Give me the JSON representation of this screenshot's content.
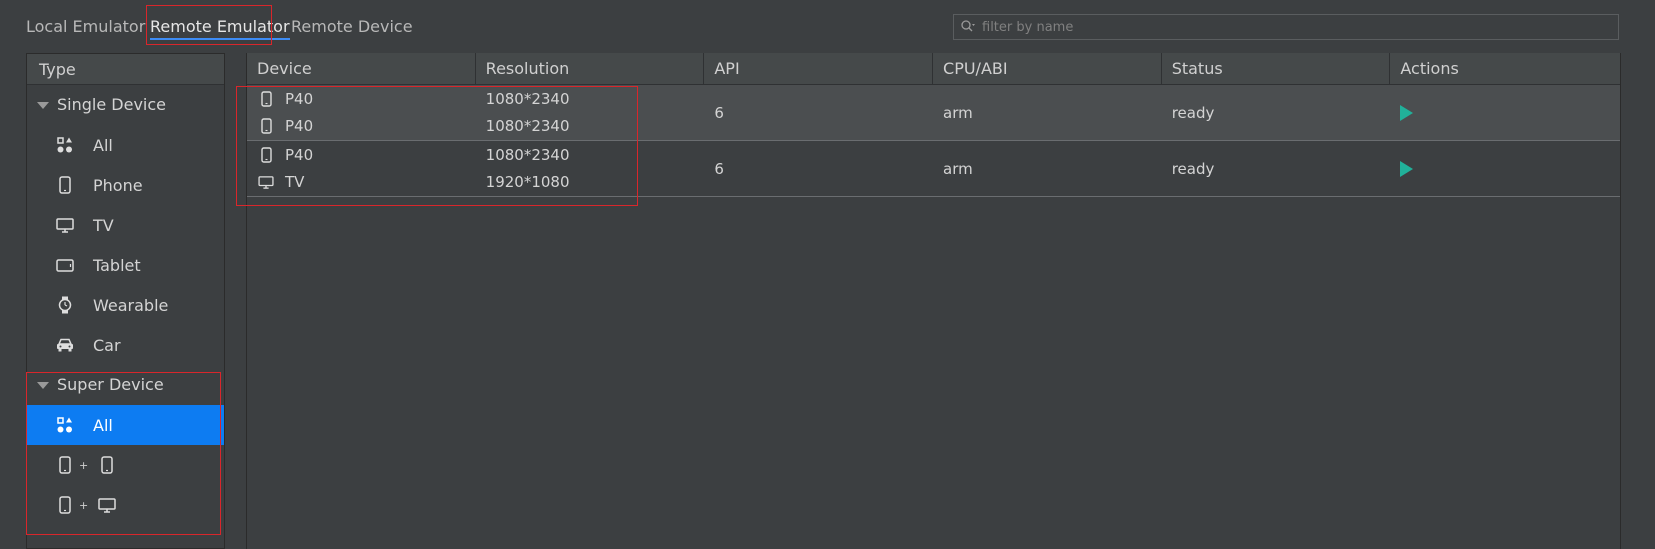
{
  "tabs": {
    "local": "Local Emulator",
    "remote_emulator": "Remote Emulator",
    "remote_device": "Remote Device"
  },
  "search": {
    "placeholder": "filter by name"
  },
  "sidebar": {
    "header": "Type",
    "single_group": "Single Device",
    "single_items": [
      {
        "label": "All",
        "icon": "grid-icon"
      },
      {
        "label": "Phone",
        "icon": "phone-icon"
      },
      {
        "label": "TV",
        "icon": "tv-icon"
      },
      {
        "label": "Tablet",
        "icon": "tablet-icon"
      },
      {
        "label": "Wearable",
        "icon": "watch-icon"
      },
      {
        "label": "Car",
        "icon": "car-icon"
      }
    ],
    "super_group": "Super Device",
    "super_items": [
      {
        "label": "All",
        "icon": "grid-icon"
      },
      {
        "plus": "+",
        "icons": [
          "phone-icon",
          "phone-icon"
        ]
      },
      {
        "plus": "+",
        "icons": [
          "phone-icon",
          "tv-icon"
        ]
      }
    ]
  },
  "table": {
    "columns": [
      "Device",
      "Resolution",
      "API",
      "CPU/ABI",
      "Status",
      "Actions"
    ],
    "rows": [
      {
        "devices": [
          {
            "name": "P40",
            "icon": "phone-icon",
            "resolution": "1080*2340"
          },
          {
            "name": "P40",
            "icon": "phone-icon",
            "resolution": "1080*2340"
          }
        ],
        "api": "6",
        "cpu": "arm",
        "status": "ready"
      },
      {
        "devices": [
          {
            "name": "P40",
            "icon": "phone-icon",
            "resolution": "1080*2340"
          },
          {
            "name": "TV",
            "icon": "tv-icon",
            "resolution": "1920*1080"
          }
        ],
        "api": "6",
        "cpu": "arm",
        "status": "ready"
      }
    ]
  },
  "colors": {
    "accent": "#0d7cf2",
    "play": "#21b19a",
    "highlight": "#d9262b"
  }
}
